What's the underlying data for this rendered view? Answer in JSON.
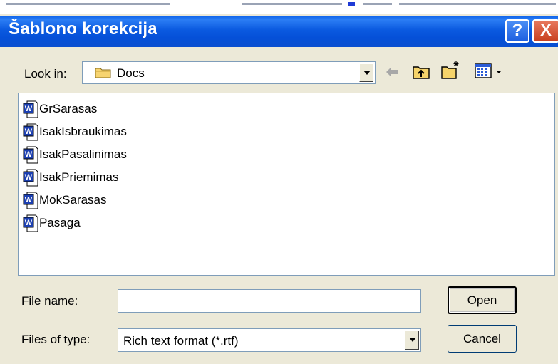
{
  "dialog": {
    "title": "Šablono korekcija",
    "help_glyph": "?",
    "close_glyph": "X"
  },
  "lookin": {
    "label": "Look in:",
    "value": "Docs"
  },
  "files": [
    {
      "name": "GrSarasas"
    },
    {
      "name": "IsakIsbraukimas"
    },
    {
      "name": "IsakPasalinimas"
    },
    {
      "name": "IsakPriemimas"
    },
    {
      "name": "MokSarasas"
    },
    {
      "name": "Pasaga"
    }
  ],
  "filename": {
    "label": "File name:",
    "value": ""
  },
  "filetype": {
    "label": "Files of type:",
    "value": "Rich text format (*.rtf)"
  },
  "buttons": {
    "open": "Open",
    "cancel": "Cancel"
  },
  "colors": {
    "titlebar": "#0a5fe8",
    "dialog_bg": "#ece9d8",
    "close": "#c8401f"
  }
}
